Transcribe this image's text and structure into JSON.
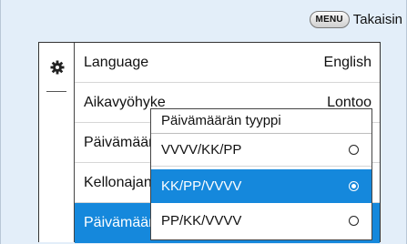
{
  "header": {
    "menu_key": "MENU",
    "back_label": "Takaisin"
  },
  "menu": {
    "icon": "gear-icon",
    "items": [
      {
        "label": "Language",
        "value": "English"
      },
      {
        "label": "Aikavyöhyke",
        "value": "Lontoo"
      },
      {
        "label": "Päivämäärä",
        "value": ""
      },
      {
        "label": "Kellonajan",
        "value": ""
      },
      {
        "label": "Päivämäär",
        "value": ""
      }
    ],
    "selected_index": 4
  },
  "dropdown": {
    "title": "Päivämäärän tyyppi",
    "options": [
      {
        "label": "VVVV/KK/PP",
        "selected": false
      },
      {
        "label": "KK/PP/VVVV",
        "selected": true
      },
      {
        "label": "PP/KK/VVVV",
        "selected": false
      }
    ]
  },
  "colors": {
    "highlight": "#1588dc",
    "background": "#e3eef9"
  }
}
